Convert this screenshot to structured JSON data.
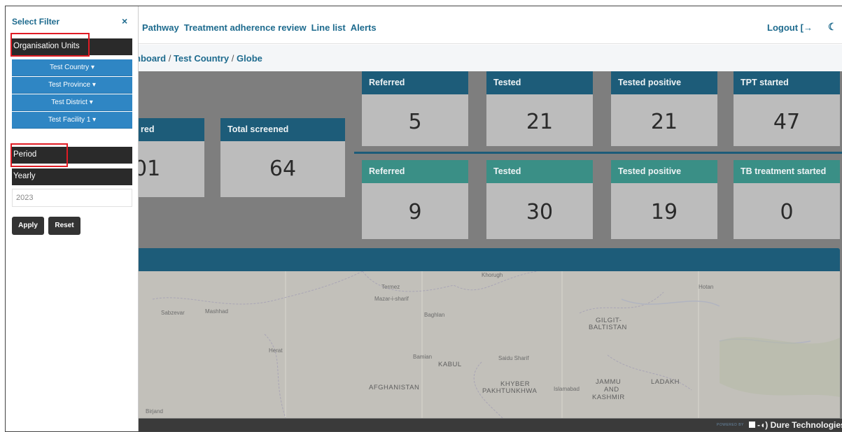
{
  "nav": {
    "links": [
      "Pathway",
      "Treatment adherence review",
      "Line list",
      "Alerts"
    ],
    "logout_label": "Logout",
    "logout_icon": "[→",
    "theme_icon": "☾"
  },
  "breadcrumb": {
    "items": [
      "nboard",
      "Test Country",
      "Globe"
    ],
    "separator": "/"
  },
  "left_cards": [
    {
      "label": "red",
      "value": "01"
    },
    {
      "label": "Total screened",
      "value": "64"
    }
  ],
  "top_row": [
    {
      "label": "Referred",
      "value": "5"
    },
    {
      "label": "Tested",
      "value": "21"
    },
    {
      "label": "Tested positive",
      "value": "21"
    },
    {
      "label": "TPT started",
      "value": "47"
    }
  ],
  "bottom_row": [
    {
      "label": "Referred",
      "value": "9"
    },
    {
      "label": "Tested",
      "value": "30"
    },
    {
      "label": "Tested positive",
      "value": "19"
    },
    {
      "label": "TB treatment started",
      "value": "0"
    }
  ],
  "map_labels": {
    "termez": "Termez",
    "mazar": "Mazar-i-sharif",
    "baghlan": "Baghlan",
    "sabzevar": "Sabzevar",
    "mashhad": "Mashhad",
    "herat": "Herat",
    "bamian": "Bamian",
    "kabul": "KABUL",
    "afghanistan": "AFGHANISTAN",
    "khyber": "KHYBER",
    "pakhtunkhwa": "PAKHTUNKHWA",
    "islamabad": "Islamabad",
    "saidu": "Saidu Sharif",
    "gilgit": "GILGIT-",
    "baltistan": "BALTISTAN",
    "jammu": "JAMMU",
    "and": "AND",
    "kashmir": "KASHMIR",
    "ladakh": "LADAKH",
    "khorugh": "Khorugh",
    "hotan": "Hotan",
    "birjand": "Birjand"
  },
  "footer": {
    "powered_by": "POWERED BY",
    "company": "-◖) Dure Technologies"
  },
  "filter": {
    "title": "Select Filter",
    "close_icon": "×",
    "org_units_label": "Organisation Units",
    "org_levels": [
      "Test Country ▾",
      "Test Province ▾",
      "Test District ▾",
      "Test Facility 1 ▾"
    ],
    "period_label": "Period",
    "period_type": "Yearly",
    "period_value": "2023",
    "apply_label": "Apply",
    "reset_label": "Reset"
  },
  "colors": {
    "highlight": "#e01b24",
    "card_header_blue": "#1d5c79",
    "card_header_teal": "#3a8f86",
    "org_button": "#2f86c4"
  }
}
